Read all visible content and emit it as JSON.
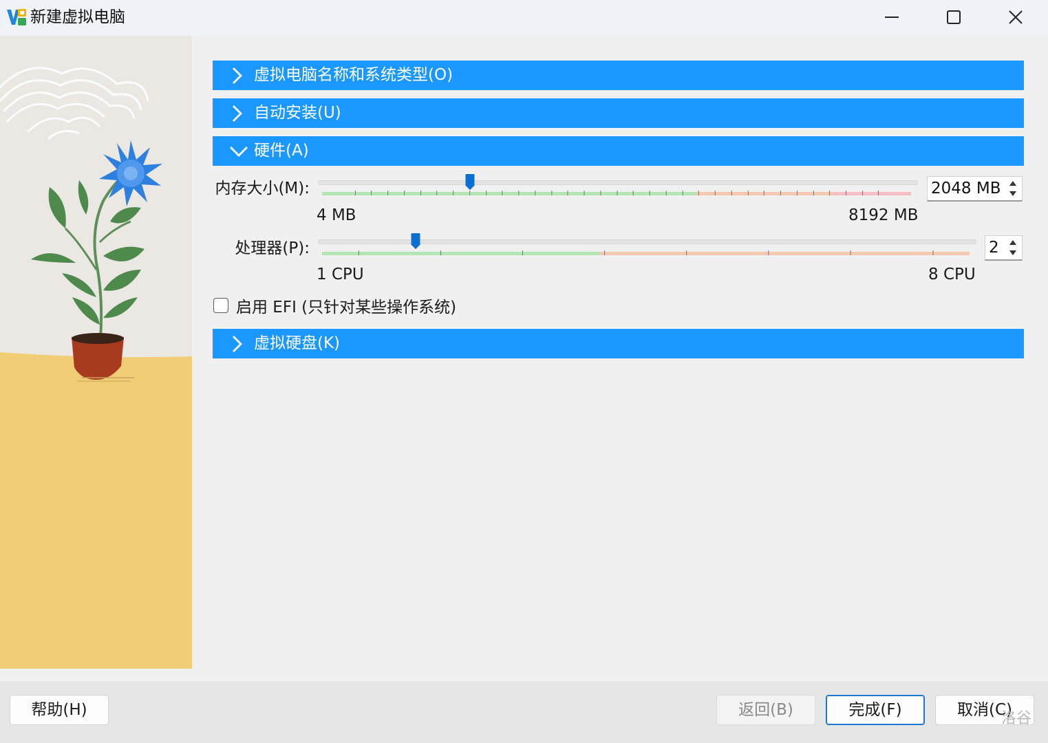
{
  "window": {
    "title": "新建虚拟电脑",
    "icons": {
      "logo": "virtualbox-logo-icon",
      "minimize": "minimize-icon",
      "maximize": "maximize-icon",
      "close": "close-icon"
    }
  },
  "sections": {
    "name_type": {
      "label": "虚拟电脑名称和系统类型(O)",
      "expanded": false
    },
    "unattended": {
      "label": "自动安装(U)",
      "expanded": false
    },
    "hardware": {
      "label": "硬件(A)",
      "expanded": true
    },
    "disk": {
      "label": "虚拟硬盘(K)",
      "expanded": false
    }
  },
  "hardware": {
    "memory": {
      "label": "内存大小(M):",
      "value_text": "2048 MB",
      "value": 2048,
      "min_label": "4 MB",
      "max_label": "8192 MB"
    },
    "cpu": {
      "label": "处理器(P):",
      "value_text": "2",
      "value": 2,
      "min_label": "1 CPU",
      "max_label": "8 CPU"
    },
    "efi": {
      "label": "启用 EFI (只针对某些操作系统)",
      "checked": false
    }
  },
  "footer": {
    "help_label": "帮助(H)",
    "back_label": "返回(B)",
    "finish_label": "完成(F)",
    "cancel_label": "取消(C)"
  },
  "watermark": "洛谷",
  "colors": {
    "section_bar": "#1a98ff",
    "slider_safe": "#b4e6b4",
    "slider_warn": "#f5c9b0",
    "slider_danger": "#f7bcc4",
    "thumb": "#0a6fd0",
    "finish_border": "#1a78d2"
  }
}
